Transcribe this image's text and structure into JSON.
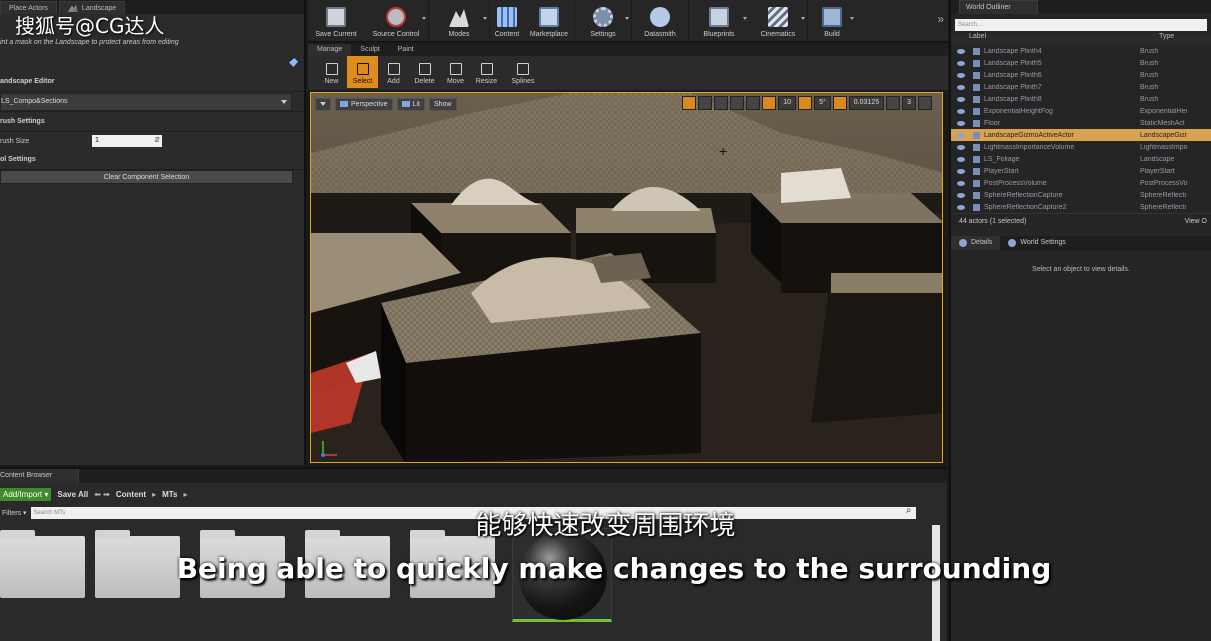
{
  "watermark": "搜狐号@CG达人",
  "subtitles": {
    "chinese": "能够快速改变周围环境",
    "english": "Being able to quickly make changes to the surrounding"
  },
  "left_panel": {
    "tabs": [
      "Place Actors",
      "Landscape"
    ],
    "hint": "int a mask on the Landscape to protect areas from editing",
    "section_landscape_editor": "andscape Editor",
    "dropdown_value": "LS_Compo&Sections",
    "section_brush": "rush Settings",
    "brush_size_label": "rush Size",
    "brush_size_value": "1",
    "section_tool": "ol Settings",
    "clear_button": "Clear Component Selection"
  },
  "toolbar": {
    "buttons": [
      {
        "label": "Save Current",
        "icon": "save-icon"
      },
      {
        "label": "Source Control",
        "icon": "source-control-icon"
      },
      {
        "label": "Modes",
        "icon": "modes-icon"
      },
      {
        "label": "Content",
        "icon": "content-icon"
      },
      {
        "label": "Marketplace",
        "icon": "marketplace-icon"
      },
      {
        "label": "Settings",
        "icon": "settings-icon"
      },
      {
        "label": "Datasmith",
        "icon": "datasmith-icon"
      },
      {
        "label": "Blueprints",
        "icon": "blueprints-icon"
      },
      {
        "label": "Cinematics",
        "icon": "cinematics-icon"
      },
      {
        "label": "Build",
        "icon": "build-icon"
      }
    ],
    "more": "»"
  },
  "mode_tabs": [
    "Manage",
    "Sculpt",
    "Paint"
  ],
  "tools": [
    "New",
    "Select",
    "Add",
    "Delete",
    "Move",
    "Resize",
    "Splines"
  ],
  "viewport": {
    "perspective": "Perspective",
    "lit": "Lit",
    "show": "Show",
    "grid_snap": "10",
    "rot_snap": "5°",
    "scale_snap": "0.03125",
    "camera_speed": "3"
  },
  "world_outliner": {
    "tab": "World Outliner",
    "search_placeholder": "Search...",
    "col_label": "Label",
    "col_type": "Type",
    "rows": [
      {
        "name": "Landscape Plinth4",
        "type": "Brush"
      },
      {
        "name": "Landscape Plinth5",
        "type": "Brush"
      },
      {
        "name": "Landscape Plinth6",
        "type": "Brush"
      },
      {
        "name": "Landscape Plinth7",
        "type": "Brush"
      },
      {
        "name": "Landscape Plinth8",
        "type": "Brush"
      },
      {
        "name": "ExponentialHeightFog",
        "type": "ExponentialHei"
      },
      {
        "name": "Floor",
        "type": "StaticMeshAct"
      },
      {
        "name": "LandscapeGizmoActiveActor",
        "type": "LandscapeGizr"
      },
      {
        "name": "LightmassImportanceVolume",
        "type": "LightmassImpo"
      },
      {
        "name": "LS_Foliage",
        "type": "Landscape"
      },
      {
        "name": "PlayerStart",
        "type": "PlayerStart"
      },
      {
        "name": "PostProcessVolume",
        "type": "PostProcessVo"
      },
      {
        "name": "SphereReflectionCapture",
        "type": "SphereReflecti"
      },
      {
        "name": "SphereReflectionCapture2",
        "type": "SphereReflecti"
      }
    ],
    "selected_index": 7,
    "footer": "44 actors (1 selected)",
    "view_options": "View O"
  },
  "details": {
    "tab_details": "Details",
    "tab_world_settings": "World Settings",
    "empty_message": "Select an object to view details."
  },
  "content_browser": {
    "tab": "Content Browser",
    "add_import": "Add/Import ▾",
    "save_all": "Save All",
    "nav": "⬅ ➡",
    "crumbs": [
      "Content",
      "MTs"
    ],
    "filters": "Filters ▾",
    "search_placeholder": "Search MTs"
  },
  "colors": {
    "accent_orange": "#e08c1a",
    "add_green": "#3f8a2b",
    "selection": "#d8a250"
  }
}
